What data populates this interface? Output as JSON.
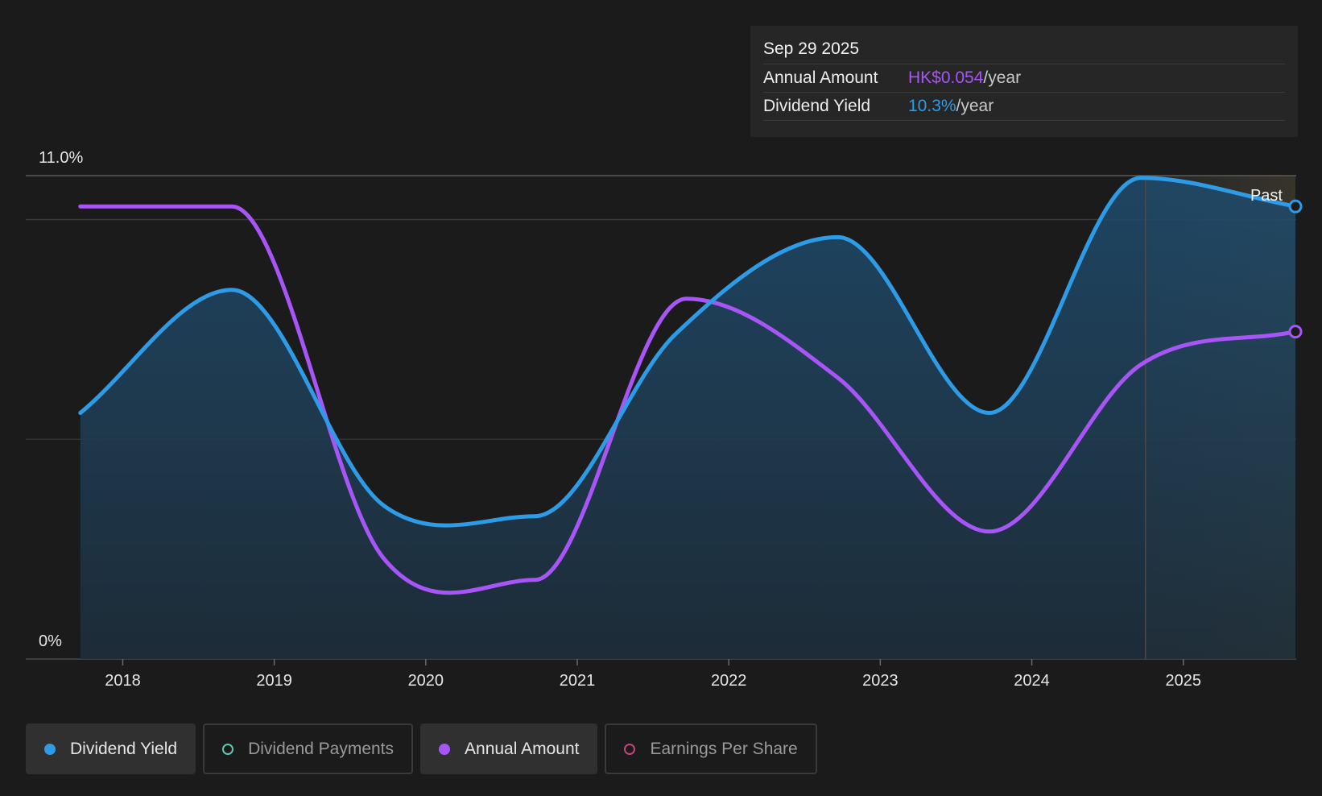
{
  "tooltip": {
    "date": "Sep 29 2025",
    "rows": [
      {
        "label": "Annual Amount",
        "value": "HK$0.054",
        "unit": "/year"
      },
      {
        "label": "Dividend Yield",
        "value": "10.3%",
        "unit": "/year"
      }
    ]
  },
  "legend": [
    {
      "label": "Dividend Yield",
      "active": true,
      "color": "#2e9be6"
    },
    {
      "label": "Dividend Payments",
      "active": false,
      "color": "#5ec8b4"
    },
    {
      "label": "Annual Amount",
      "active": true,
      "color": "#a855f7"
    },
    {
      "label": "Earnings Per Share",
      "active": false,
      "color": "#c2457e"
    }
  ],
  "chart_data": {
    "type": "line",
    "ylim": [
      0,
      11.0
    ],
    "y_tick_labels": [
      "11.0%",
      "0%"
    ],
    "x_ticks": [
      2018,
      2019,
      2020,
      2021,
      2022,
      2023,
      2024,
      2025
    ],
    "xlim": [
      2017.7,
      2025.74
    ],
    "past_marker": {
      "x": 2024.75,
      "label": "Past"
    },
    "series": [
      {
        "name": "Dividend Yield",
        "color": "#2e9be6",
        "points": [
          [
            2017.72,
            5.6
          ],
          [
            2018.72,
            8.4
          ],
          [
            2019.72,
            3.5
          ],
          [
            2020.72,
            3.25
          ],
          [
            2021.65,
            7.4
          ],
          [
            2022.72,
            9.6
          ],
          [
            2023.72,
            5.6
          ],
          [
            2024.72,
            10.95
          ],
          [
            2025.74,
            10.3
          ]
        ]
      },
      {
        "name": "Annual Amount",
        "color": "#a855f7",
        "axis_note": "plotted on secondary scale",
        "points": [
          [
            2017.72,
            10.3
          ],
          [
            2018.72,
            10.3
          ],
          [
            2019.72,
            2.3
          ],
          [
            2020.72,
            1.8
          ],
          [
            2021.72,
            8.2
          ],
          [
            2022.72,
            6.4
          ],
          [
            2023.72,
            2.9
          ],
          [
            2024.72,
            6.7
          ],
          [
            2025.74,
            7.45
          ]
        ]
      }
    ]
  }
}
